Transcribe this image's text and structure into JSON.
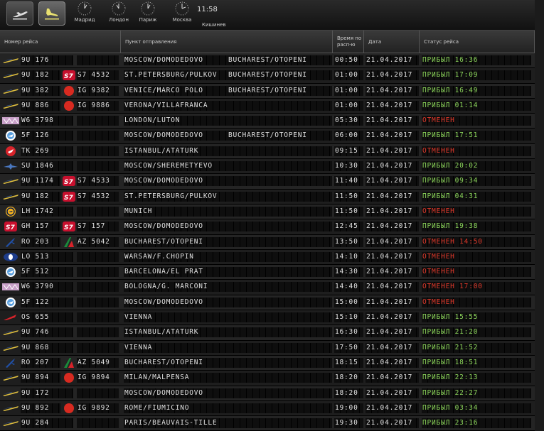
{
  "topbar": {
    "departures_button": "departures-icon",
    "arrivals_button": "arrivals-icon",
    "clocks": [
      {
        "city": "Мадрид"
      },
      {
        "city": "Лондон"
      },
      {
        "city": "Париж"
      },
      {
        "city": "Москва"
      }
    ],
    "current_time": "11:58",
    "current_city": "Кишинев"
  },
  "header": {
    "flight": "Номер рейса",
    "origin": "Пункт отправления",
    "scheduled": "Время по расп-ю",
    "date": "Дата",
    "status": "Статус рейса"
  },
  "colors": {
    "ok": "#8bd45a",
    "cancel": "#e0392b"
  },
  "flights": [
    {
      "logo": "utair",
      "flight": "9U 176",
      "codeshare_logo": "",
      "codeshare": "",
      "dest1": "MOSCOW/DOMODEDOVO",
      "dest2": "BUCHAREST/OTOPENI",
      "time": "00:50",
      "date": "21.04.2017",
      "status": "ПРИБЫЛ 16:36",
      "status_type": "ok"
    },
    {
      "logo": "utair",
      "flight": "9U 182",
      "codeshare_logo": "s7",
      "codeshare": "S7 4532",
      "dest1": "ST.PETERSBURG/PULKOV",
      "dest2": "BUCHAREST/OTOPENI",
      "time": "01:00",
      "date": "21.04.2017",
      "status": "ПРИБЫЛ 17:09",
      "status_type": "ok"
    },
    {
      "logo": "utair",
      "flight": "9U 382",
      "codeshare_logo": "ig",
      "codeshare": "IG 9382",
      "dest1": "VENICE/MARCO POLO",
      "dest2": "BUCHAREST/OTOPENI",
      "time": "01:00",
      "date": "21.04.2017",
      "status": "ПРИБЫЛ 16:49",
      "status_type": "ok"
    },
    {
      "logo": "utair",
      "flight": "9U 886",
      "codeshare_logo": "ig",
      "codeshare": "IG 9886",
      "dest1": "VERONA/VILLAFRANCA",
      "dest2": "",
      "time": "01:00",
      "date": "21.04.2017",
      "status": "ПРИБЫЛ 01:14",
      "status_type": "ok"
    },
    {
      "logo": "wizz",
      "flight": "W6 3798",
      "codeshare_logo": "",
      "codeshare": "",
      "dest1": "LONDON/LUTON",
      "dest2": "",
      "time": "05:30",
      "date": "21.04.2017",
      "status": "ОТМЕНЕН",
      "status_type": "cancel"
    },
    {
      "logo": "fly",
      "flight": "5F 126",
      "codeshare_logo": "",
      "codeshare": "",
      "dest1": "MOSCOW/DOMODEDOVO",
      "dest2": "BUCHAREST/OTOPENI",
      "time": "06:00",
      "date": "21.04.2017",
      "status": "ПРИБЫЛ 17:51",
      "status_type": "ok"
    },
    {
      "logo": "turkish",
      "flight": "TK 269",
      "codeshare_logo": "",
      "codeshare": "",
      "dest1": "ISTANBUL/ATATURK",
      "dest2": "",
      "time": "09:15",
      "date": "21.04.2017",
      "status": "ОТМЕНЕН",
      "status_type": "cancel"
    },
    {
      "logo": "aeroflot",
      "flight": "SU 1846",
      "codeshare_logo": "",
      "codeshare": "",
      "dest1": "MOSCOW/SHEREMETYEVO",
      "dest2": "",
      "time": "10:30",
      "date": "21.04.2017",
      "status": "ПРИБЫЛ 20:02",
      "status_type": "ok"
    },
    {
      "logo": "utair",
      "flight": "9U 1174",
      "codeshare_logo": "s7",
      "codeshare": "S7 4533",
      "dest1": "MOSCOW/DOMODEDOVO",
      "dest2": "",
      "time": "11:40",
      "date": "21.04.2017",
      "status": "ПРИБЫЛ 09:34",
      "status_type": "ok"
    },
    {
      "logo": "utair",
      "flight": "9U 182",
      "codeshare_logo": "s7",
      "codeshare": "S7 4532",
      "dest1": "ST.PETERSBURG/PULKOV",
      "dest2": "",
      "time": "11:50",
      "date": "21.04.2017",
      "status": "ПРИБЫЛ 04:31",
      "status_type": "ok"
    },
    {
      "logo": "lufthansa",
      "flight": "LH 1742",
      "codeshare_logo": "",
      "codeshare": "",
      "dest1": "MUNICH",
      "dest2": "",
      "time": "11:50",
      "date": "21.04.2017",
      "status": "ОТМЕНЕН",
      "status_type": "cancel"
    },
    {
      "logo": "s7",
      "flight": "GH 157",
      "codeshare_logo": "s7",
      "codeshare": "S7 157",
      "dest1": "MOSCOW/DOMODEDOVO",
      "dest2": "",
      "time": "12:45",
      "date": "21.04.2017",
      "status": "ПРИБЫЛ 19:38",
      "status_type": "ok"
    },
    {
      "logo": "tarom",
      "flight": "RO 203",
      "codeshare_logo": "alitalia",
      "codeshare": "AZ 5042",
      "dest1": "BUCHAREST/OTOPENI",
      "dest2": "",
      "time": "13:50",
      "date": "21.04.2017",
      "status": "ОТМЕНЕН 14:50",
      "status_type": "cancel"
    },
    {
      "logo": "lot",
      "flight": "LO 513",
      "codeshare_logo": "",
      "codeshare": "",
      "dest1": "WARSAW/F.CHOPIN",
      "dest2": "",
      "time": "14:10",
      "date": "21.04.2017",
      "status": "ОТМЕНЕН",
      "status_type": "cancel"
    },
    {
      "logo": "fly",
      "flight": "5F 512",
      "codeshare_logo": "",
      "codeshare": "",
      "dest1": "BARCELONA/EL PRAT",
      "dest2": "",
      "time": "14:30",
      "date": "21.04.2017",
      "status": "ОТМЕНЕН",
      "status_type": "cancel"
    },
    {
      "logo": "wizz",
      "flight": "W6 3790",
      "codeshare_logo": "",
      "codeshare": "",
      "dest1": "BOLOGNA/G. MARCONI",
      "dest2": "",
      "time": "14:40",
      "date": "21.04.2017",
      "status": "ОТМЕНЕН 17:00",
      "status_type": "cancel"
    },
    {
      "logo": "fly",
      "flight": "5F 122",
      "codeshare_logo": "",
      "codeshare": "",
      "dest1": "MOSCOW/DOMODEDOVO",
      "dest2": "",
      "time": "15:00",
      "date": "21.04.2017",
      "status": "ОТМЕНЕН",
      "status_type": "cancel"
    },
    {
      "logo": "austrian",
      "flight": "OS 655",
      "codeshare_logo": "",
      "codeshare": "",
      "dest1": "VIENNA",
      "dest2": "",
      "time": "15:10",
      "date": "21.04.2017",
      "status": "ПРИБЫЛ 15:55",
      "status_type": "ok"
    },
    {
      "logo": "utair",
      "flight": "9U 746",
      "codeshare_logo": "",
      "codeshare": "",
      "dest1": "ISTANBUL/ATATURK",
      "dest2": "",
      "time": "16:30",
      "date": "21.04.2017",
      "status": "ПРИБЫЛ 21:20",
      "status_type": "ok"
    },
    {
      "logo": "utair",
      "flight": "9U 868",
      "codeshare_logo": "",
      "codeshare": "",
      "dest1": "VIENNA",
      "dest2": "",
      "time": "17:50",
      "date": "21.04.2017",
      "status": "ПРИБЫЛ 21:52",
      "status_type": "ok"
    },
    {
      "logo": "tarom",
      "flight": "RO 207",
      "codeshare_logo": "alitalia",
      "codeshare": "AZ 5049",
      "dest1": "BUCHAREST/OTOPENI",
      "dest2": "",
      "time": "18:15",
      "date": "21.04.2017",
      "status": "ПРИБЫЛ 18:51",
      "status_type": "ok"
    },
    {
      "logo": "utair",
      "flight": "9U 894",
      "codeshare_logo": "ig",
      "codeshare": "IG 9894",
      "dest1": "MILAN/MALPENSA",
      "dest2": "",
      "time": "18:20",
      "date": "21.04.2017",
      "status": "ПРИБЫЛ 22:13",
      "status_type": "ok"
    },
    {
      "logo": "utair",
      "flight": "9U 172",
      "codeshare_logo": "",
      "codeshare": "",
      "dest1": "MOSCOW/DOMODEDOVO",
      "dest2": "",
      "time": "18:20",
      "date": "21.04.2017",
      "status": "ПРИБЫЛ 22:27",
      "status_type": "ok"
    },
    {
      "logo": "utair",
      "flight": "9U 892",
      "codeshare_logo": "ig",
      "codeshare": "IG 9892",
      "dest1": "ROME/FIUMICINO",
      "dest2": "",
      "time": "19:00",
      "date": "21.04.2017",
      "status": "ПРИБЫЛ 03:34",
      "status_type": "ok"
    },
    {
      "logo": "utair",
      "flight": "9U 284",
      "codeshare_logo": "",
      "codeshare": "",
      "dest1": "PARIS/BEAUVAIS-TILLE",
      "dest2": "",
      "time": "19:30",
      "date": "21.04.2017",
      "status": "ПРИБЫЛ 23:16",
      "status_type": "ok"
    }
  ]
}
